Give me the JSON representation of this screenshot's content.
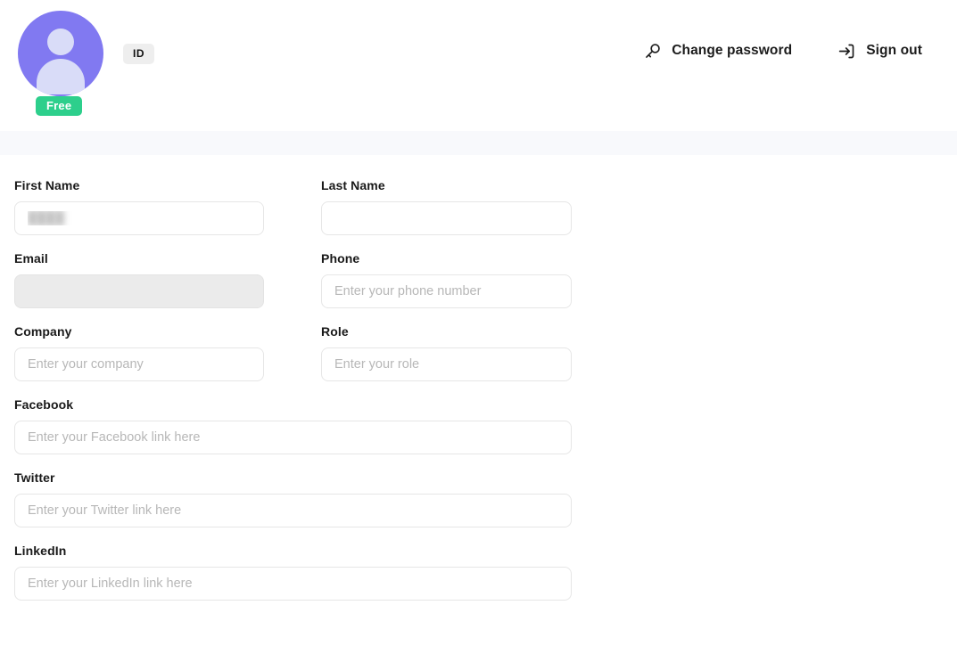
{
  "header": {
    "avatar": {
      "icon": "user-avatar-icon",
      "background_color": "#8179f1",
      "silhouette_color": "#d9dcf8"
    },
    "plan_badge": {
      "label": "Free",
      "color": "#2dcf8c"
    },
    "id_chip": {
      "label": "ID",
      "background_color": "#eeeeee"
    },
    "actions": [
      {
        "label": "Change password",
        "icon": "key-icon"
      },
      {
        "label": "Sign out",
        "icon": "sign-out-icon"
      }
    ]
  },
  "band": {
    "color": "#f8f9fc"
  },
  "form": {
    "fields": {
      "first_name": {
        "label": "First Name",
        "placeholder": "",
        "value": "████"
      },
      "last_name": {
        "label": "Last Name",
        "placeholder": "",
        "value": ""
      },
      "email": {
        "label": "Email",
        "placeholder": "",
        "value": "",
        "state": "disabled"
      },
      "phone": {
        "label": "Phone",
        "placeholder": "Enter your phone number",
        "value": ""
      },
      "company": {
        "label": "Company",
        "placeholder": "Enter your company",
        "value": ""
      },
      "role": {
        "label": "Role",
        "placeholder": "Enter your role",
        "value": ""
      },
      "facebook": {
        "label": "Facebook",
        "placeholder": "Enter your Facebook link here",
        "value": ""
      },
      "twitter": {
        "label": "Twitter",
        "placeholder": "Enter your Twitter link here",
        "value": ""
      },
      "linkedin": {
        "label": "LinkedIn",
        "placeholder": "Enter your LinkedIn link here",
        "value": ""
      }
    }
  }
}
